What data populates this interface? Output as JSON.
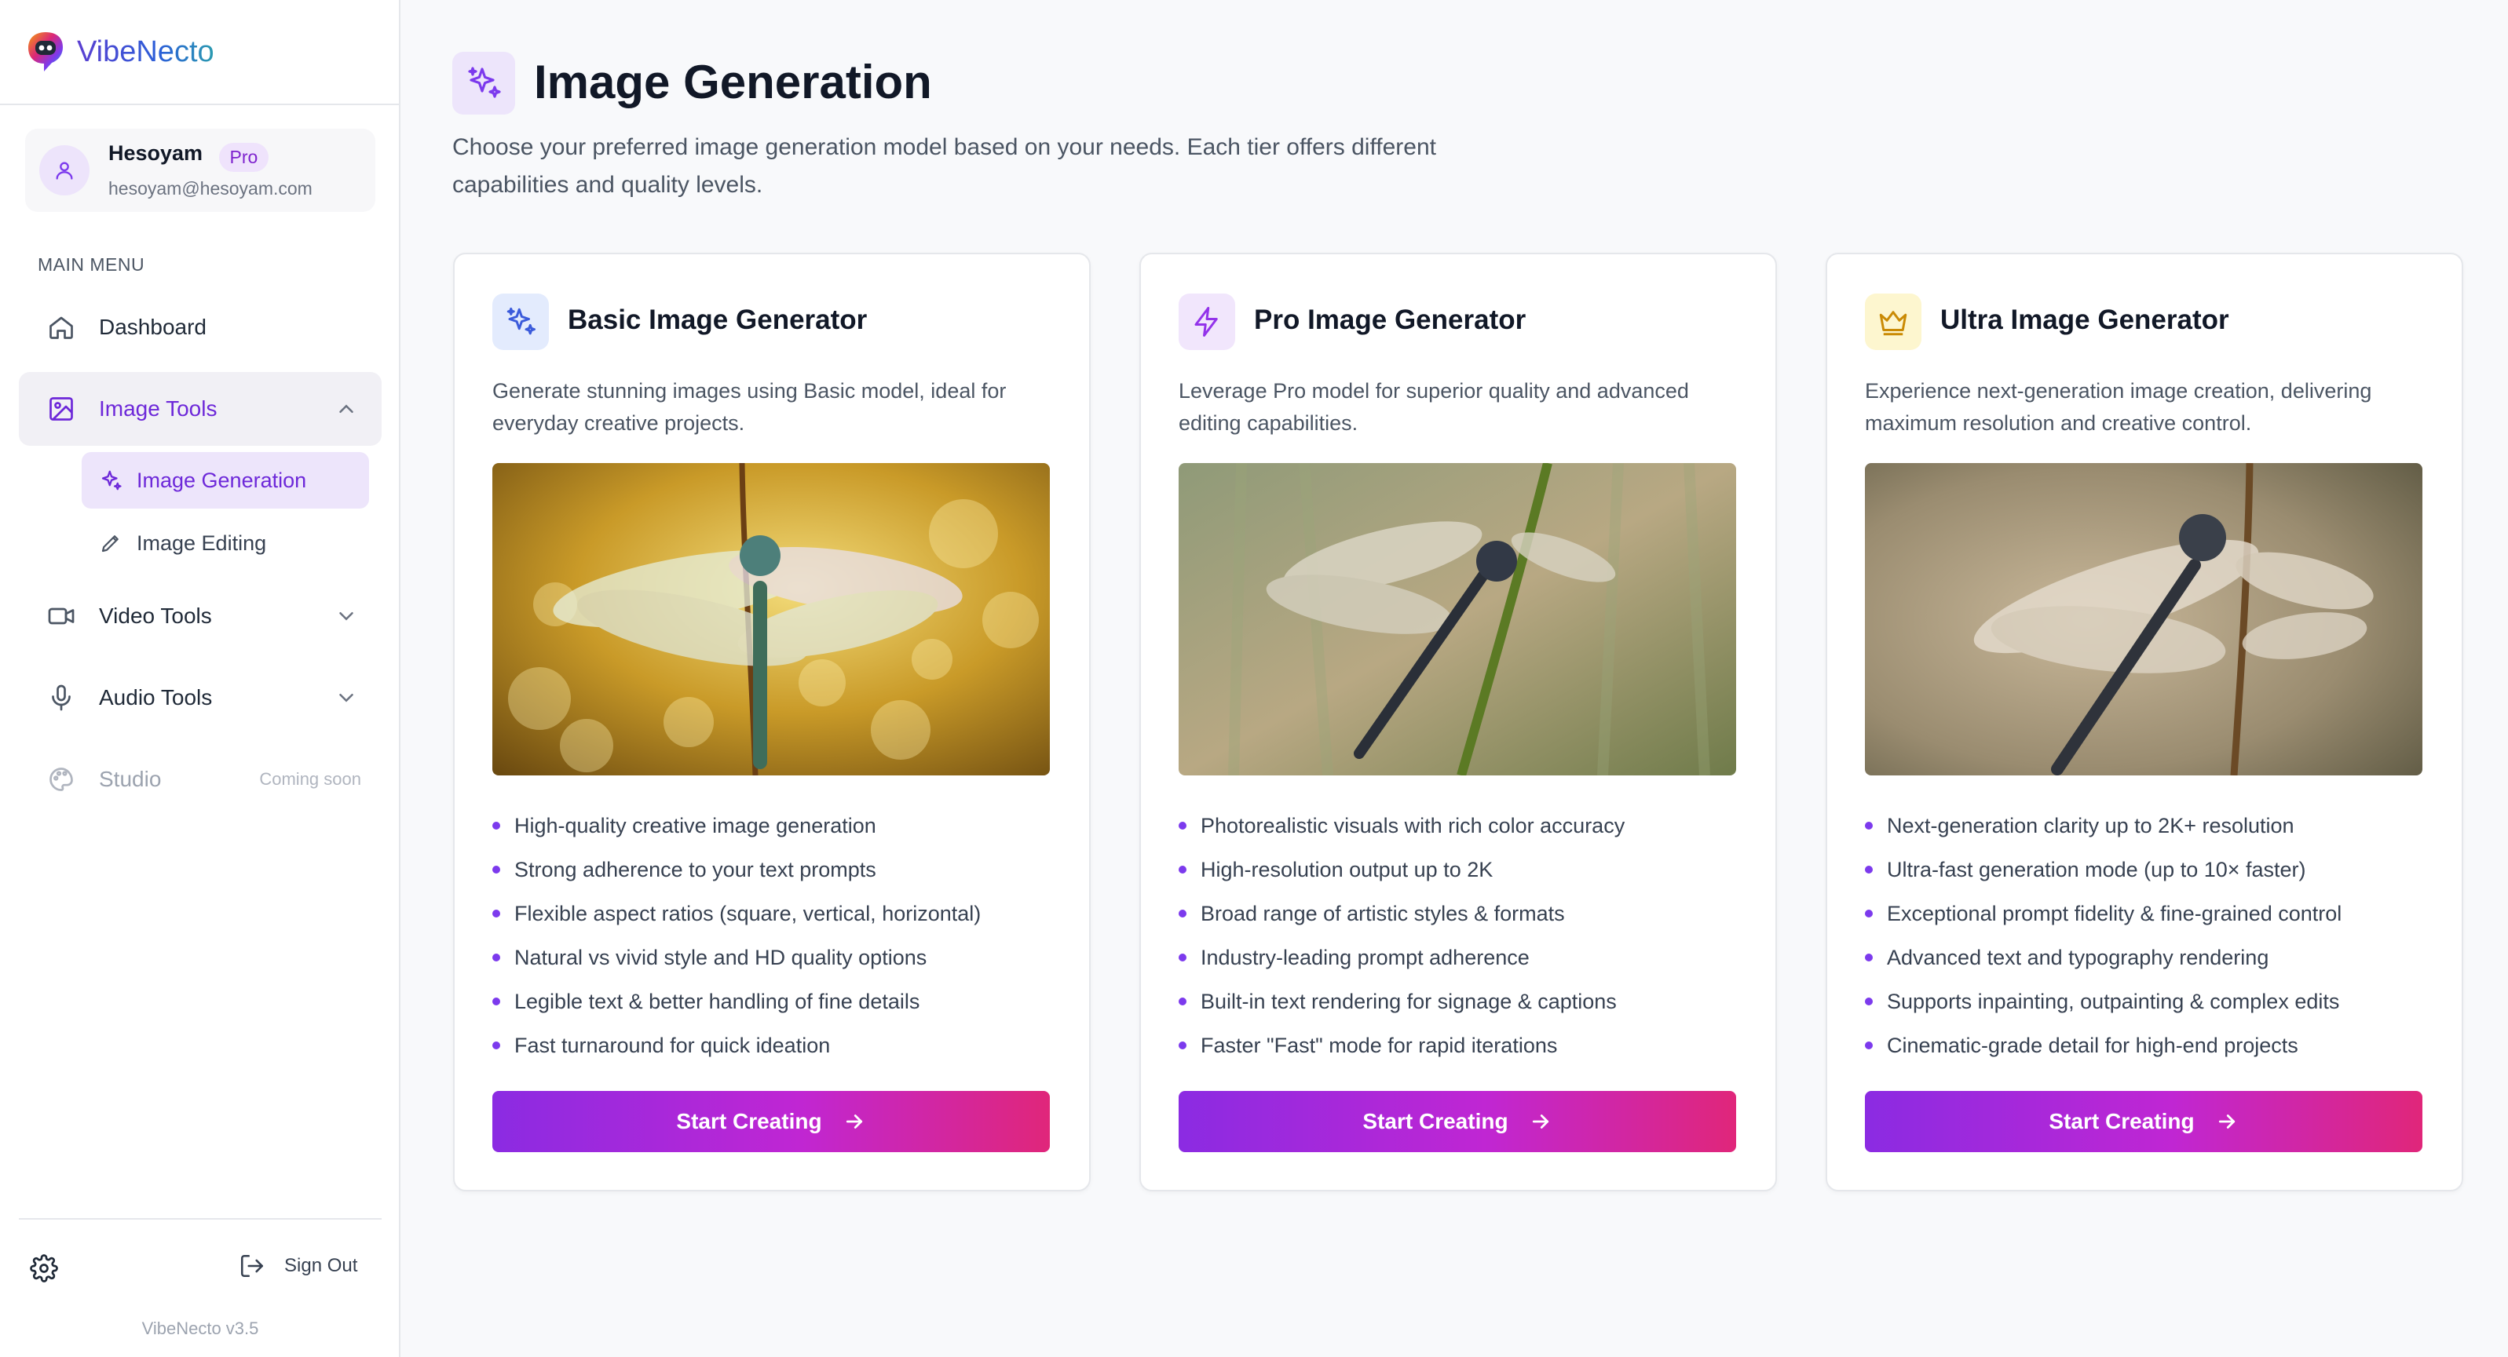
{
  "app": {
    "name": "VibeNecto",
    "version": "VibeNecto v3.5"
  },
  "user": {
    "name": "Hesoyam",
    "badge": "Pro",
    "email": "hesoyam@hesoyam.com"
  },
  "sidebar": {
    "section_title": "MAIN MENU",
    "items": [
      {
        "label": "Dashboard",
        "icon": "home-icon"
      },
      {
        "label": "Image Tools",
        "icon": "image-icon",
        "expanded": true,
        "children": [
          {
            "label": "Image Generation",
            "icon": "sparkles-icon",
            "active": true
          },
          {
            "label": "Image Editing",
            "icon": "pencil-icon"
          }
        ]
      },
      {
        "label": "Video Tools",
        "icon": "video-icon"
      },
      {
        "label": "Audio Tools",
        "icon": "microphone-icon"
      },
      {
        "label": "Studio",
        "icon": "palette-icon",
        "note": "Coming soon"
      }
    ],
    "signout_label": "Sign Out"
  },
  "page": {
    "title": "Image Generation",
    "description": "Choose your preferred image generation model based on your needs. Each tier offers different capabilities and quality levels."
  },
  "cards": [
    {
      "title": "Basic Image Generator",
      "icon": "sparkles-icon",
      "icon_bg": "#e3ebfd",
      "icon_color": "#3b5bdb",
      "description": "Generate stunning images using Basic model, ideal for everyday creative projects.",
      "features": [
        "High-quality creative image generation",
        "Strong adherence to your text prompts",
        "Flexible aspect ratios (square, vertical, horizontal)",
        "Natural vs vivid style and HD quality options",
        "Legible text & better handling of fine details",
        "Fast turnaround for quick ideation"
      ],
      "button_label": "Start Creating"
    },
    {
      "title": "Pro Image Generator",
      "icon": "lightning-icon",
      "icon_bg": "#f1e6fc",
      "icon_color": "#9333ea",
      "description": "Leverage Pro model for superior quality and advanced editing capabilities.",
      "features": [
        "Photorealistic visuals with rich color accuracy",
        "High-resolution output up to 2K",
        "Broad range of artistic styles & formats",
        "Industry-leading prompt adherence",
        "Built-in text rendering for signage & captions",
        "Faster \"Fast\" mode for rapid iterations"
      ],
      "button_label": "Start Creating"
    },
    {
      "title": "Ultra Image Generator",
      "icon": "crown-icon",
      "icon_bg": "#fdf6cf",
      "icon_color": "#ca8a04",
      "description": "Experience next-generation image creation, delivering maximum resolution and creative control.",
      "features": [
        "Next-generation clarity up to 2K+ resolution",
        "Ultra-fast generation mode (up to 10× faster)",
        "Exceptional prompt fidelity & fine-grained control",
        "Advanced text and typography rendering",
        "Supports inpainting, outpainting & complex edits",
        "Cinematic-grade detail for high-end projects"
      ],
      "button_label": "Start Creating"
    }
  ],
  "colors": {
    "accent": "#7c3aed",
    "cta_start": "#8b2be2",
    "cta_end": "#e0267a"
  }
}
